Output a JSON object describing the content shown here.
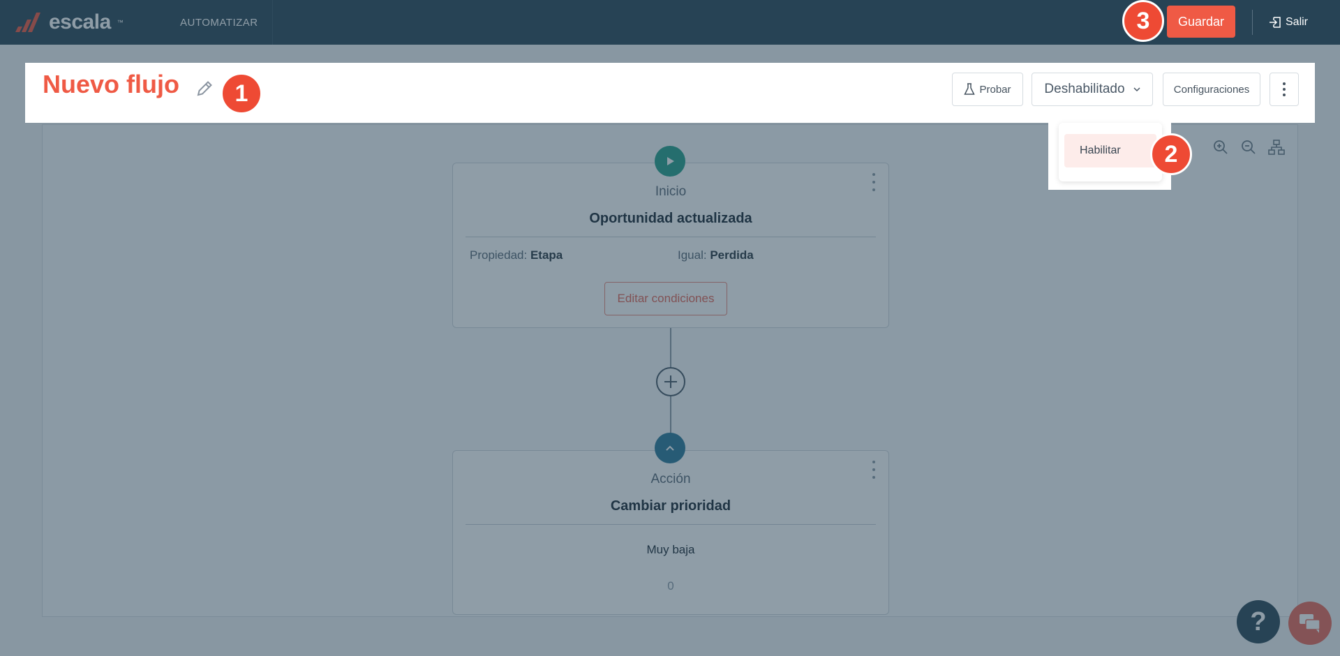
{
  "app": {
    "logo_text": "escala",
    "logo_tm": "™"
  },
  "nav": {
    "automatizar": "AUTOMATIZAR"
  },
  "topbar": {
    "save_label": "Guardar",
    "exit_label": "Salir"
  },
  "flow": {
    "title": "Nuevo flujo",
    "buttons": {
      "probar": "Probar",
      "status": "Deshabilitado",
      "config": "Configuraciones"
    },
    "status_menu": {
      "options": [
        "Habilitar"
      ]
    }
  },
  "nodes": {
    "start": {
      "type": "Inicio",
      "title": "Oportunidad actualizada",
      "condition_property_label": "Propiedad:",
      "condition_property_value": "Etapa",
      "condition_op_label": "Igual:",
      "condition_op_value": "Perdida",
      "edit_button": "Editar condiciones"
    },
    "action": {
      "type": "Acción",
      "title": "Cambiar prioridad",
      "value": "Muy baja",
      "count": "0"
    }
  },
  "steps": [
    "1",
    "2",
    "3"
  ],
  "support": {
    "help_label": "?"
  },
  "colors": {
    "brand": "#ef5a45",
    "topbar": "#2e4a5b",
    "menu_highlight": "#fdecea"
  }
}
